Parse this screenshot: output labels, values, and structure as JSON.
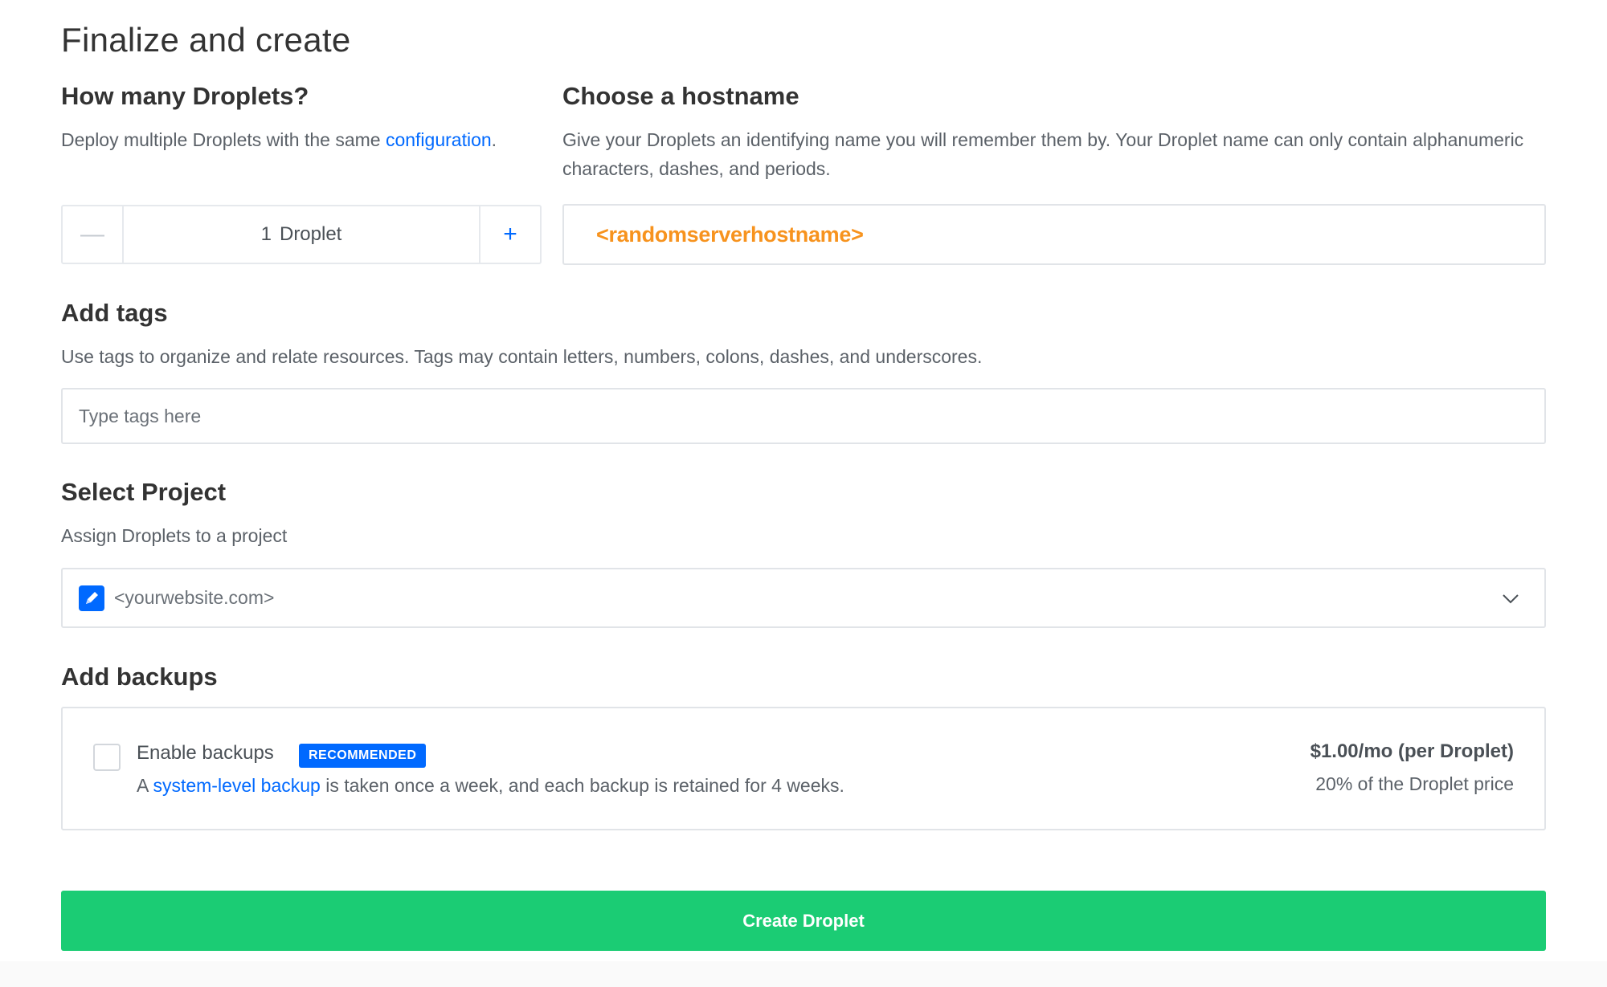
{
  "page": {
    "title": "Finalize and create"
  },
  "droplets": {
    "heading": "How many Droplets?",
    "desc_prefix": "Deploy multiple Droplets with the same ",
    "desc_link": "configuration",
    "desc_suffix": ".",
    "minus_symbol": "—",
    "plus_symbol": "+",
    "count": "1",
    "unit": "Droplet"
  },
  "hostname": {
    "heading": "Choose a hostname",
    "desc": "Give your Droplets an identifying name you will remember them by. Your Droplet name can only contain alphanumeric characters, dashes, and periods.",
    "value": "<randomserverhostname>"
  },
  "tags": {
    "heading": "Add tags",
    "desc": "Use tags to organize and relate resources. Tags may contain letters, numbers, colons, dashes, and underscores.",
    "placeholder": "Type tags here"
  },
  "project": {
    "heading": "Select Project",
    "desc": "Assign Droplets to a project",
    "selected": "<yourwebsite.com>",
    "icon": "project-pencil-icon",
    "icon_color": "#0069ff"
  },
  "backups": {
    "heading": "Add backups",
    "enable_label": "Enable backups",
    "badge": "RECOMMENDED",
    "desc_prefix": "A ",
    "desc_link": "system-level backup",
    "desc_suffix": " is taken once a week, and each backup is retained for 4 weeks.",
    "price": "$1.00/mo (per Droplet)",
    "price_note": "20% of the Droplet price",
    "enabled": false
  },
  "actions": {
    "create_label": "Create Droplet",
    "create_color": "#1bcc74"
  },
  "colors": {
    "accent": "#0069ff",
    "hostname_highlight": "#f7931e"
  }
}
